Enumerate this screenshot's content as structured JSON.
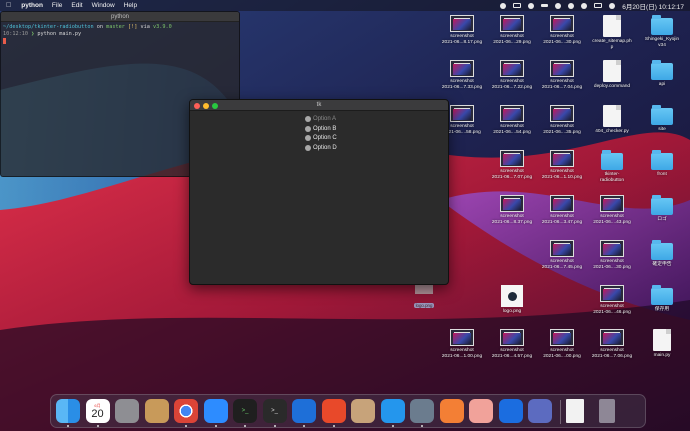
{
  "menubar": {
    "apple_icon": "apple-icon",
    "app_name": "python",
    "items": [
      "File",
      "Edit",
      "Window",
      "Help"
    ],
    "datetime": "6月20日(日)  10:12:17"
  },
  "terminal": {
    "title": "python",
    "prompt_path": "~/desktop/tkinter-radiobutton",
    "prompt_on": "on",
    "branch": "master",
    "branch_flag": "[!]",
    "prompt_via": "via",
    "python_version": "v3.9.0",
    "time": "10:12:10",
    "command": "python main.py"
  },
  "tk_window": {
    "title": "tk",
    "options": [
      "Option A",
      "Option B",
      "Option C",
      "Option D"
    ]
  },
  "desktop": {
    "icons": [
      {
        "label": "screenshot",
        "sub": "2021-06...8.17.png",
        "kind": "thumb"
      },
      {
        "label": "screenshot",
        "sub": "2021-06....29.png",
        "kind": "thumb"
      },
      {
        "label": "screenshot",
        "sub": "2021-06....30.png",
        "kind": "thumb"
      },
      {
        "label": "create_sitemap.ph",
        "sub": "p",
        "kind": "doc",
        "badge": "PHP"
      },
      {
        "label": "Shingeki_Kyojin",
        "sub": "v34",
        "kind": "folder"
      },
      {
        "label": "screenshot",
        "sub": "2021-06...7.33.png",
        "kind": "thumb"
      },
      {
        "label": "screenshot",
        "sub": "2021-06...7.22.png",
        "kind": "thumb"
      },
      {
        "label": "screenshot",
        "sub": "2021-06...7.04.png",
        "kind": "thumb"
      },
      {
        "label": "deploy.command",
        "sub": "",
        "kind": "doc",
        "badge": "SHELL"
      },
      {
        "label": "api",
        "sub": "",
        "kind": "folder"
      },
      {
        "label": "screenshot",
        "sub": "2021-06....58.png",
        "kind": "thumb"
      },
      {
        "label": "screenshot",
        "sub": "2021-06....54.png",
        "kind": "thumb"
      },
      {
        "label": "screenshot",
        "sub": "2021-06....35.png",
        "kind": "thumb"
      },
      {
        "label": "404_checker.py",
        "sub": "",
        "kind": "doc",
        "badge": "PYTHON"
      },
      {
        "label": "site",
        "sub": "",
        "kind": "folder"
      },
      {
        "label": "screenshot",
        "sub": "2021-06...7.07.png",
        "kind": "thumb"
      },
      {
        "label": "screenshot",
        "sub": "2021-06...1.10.png",
        "kind": "thumb"
      },
      {
        "label": "tkinter-",
        "sub": "radiobutton",
        "kind": "folder"
      },
      {
        "label": "front",
        "sub": "",
        "kind": "folder"
      },
      {
        "label": "screenshot",
        "sub": "2021-06...8.37.png",
        "kind": "thumb"
      },
      {
        "label": "screenshot",
        "sub": "2021-06...3.47.png",
        "kind": "thumb"
      },
      {
        "label": "screenshot",
        "sub": "2021-06....43.png",
        "kind": "thumb"
      },
      {
        "label": "ロゴ",
        "sub": "",
        "kind": "folder"
      },
      {
        "label": "screenshot",
        "sub": "2021-06...7.45.png",
        "kind": "thumb"
      },
      {
        "label": "screenshot",
        "sub": "2021-06....30.png",
        "kind": "thumb"
      },
      {
        "label": "確定申告",
        "sub": "",
        "kind": "folder"
      },
      {
        "label": "logo.png",
        "sub": "",
        "kind": "logo"
      },
      {
        "label": "screenshot",
        "sub": "2021-06....46.png",
        "kind": "thumb"
      },
      {
        "label": "保存用",
        "sub": "",
        "kind": "folder"
      },
      {
        "label": "screenshot",
        "sub": "2021-06...1.00.png",
        "kind": "thumb"
      },
      {
        "label": "screenshot",
        "sub": "2021-06...4.57.png",
        "kind": "thumb"
      },
      {
        "label": "screenshot",
        "sub": "2021-06....00.png",
        "kind": "thumb"
      },
      {
        "label": "screenshot",
        "sub": "2021-06...7.06.png",
        "kind": "thumb"
      },
      {
        "label": "main.py",
        "sub": "",
        "kind": "doc",
        "badge": "PYTHON"
      }
    ],
    "dragging_label": "logo.png"
  },
  "dock": {
    "calendar_day": "20",
    "calendar_month": "6月",
    "apps": [
      "finder-icon",
      "calendar-icon",
      "system-preferences-icon",
      "contacts-icon",
      "chrome-icon",
      "zoom-icon",
      "activity-monitor-icon",
      "terminal-icon",
      "vscode-icon",
      "instruments-icon",
      "archive-icon",
      "docker-icon",
      "proxyman-icon",
      "sourcetree-icon",
      "preview-icon",
      "infinity-icon",
      "screenshots-stack-icon",
      "document-stack-icon",
      "trash-icon"
    ]
  }
}
